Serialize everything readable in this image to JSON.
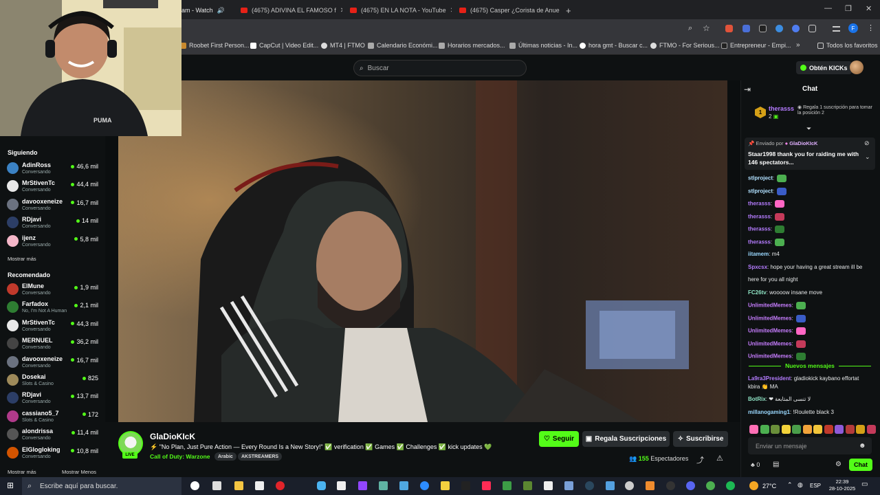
{
  "browser": {
    "tabs": [
      {
        "title": "am - Watch"
      },
      {
        "title": "(4675) ADIVINA EL FAMOSO f"
      },
      {
        "title": "(4675) EN LA NOTA - YouTube"
      },
      {
        "title": "(4675) Casper ¿Corista de Anue"
      }
    ],
    "bookmarks": [
      "Roobet First Person...",
      "CapCut | Video Edit...",
      "MT4 | FTMO",
      "Calendario Económi...",
      "Horarios mercados...",
      "Últimas noticias - In...",
      "hora gmt - Buscar c...",
      "FTMO - For Serious...",
      "Entrepreneur - Empi..."
    ],
    "all_bookmarks": "Todos los favoritos",
    "profile_initial": "F"
  },
  "header": {
    "search_placeholder": "Buscar",
    "get_kicks": "Obtén KICKs"
  },
  "sidebar": {
    "following_title": "Siguiendo",
    "following": [
      {
        "name": "AdinRoss",
        "sub": "Conversando",
        "viewers": "46,6 mil",
        "color": "#3b82c4"
      },
      {
        "name": "MrStivenTc",
        "sub": "Conversando",
        "viewers": "44,4 mil",
        "color": "#e8e8e8"
      },
      {
        "name": "davooxeneize",
        "sub": "Conversando",
        "viewers": "16,7 mil",
        "color": "#6b7280"
      },
      {
        "name": "RDjavi",
        "sub": "Conversando",
        "viewers": "14 mil",
        "color": "#2c3e66"
      },
      {
        "name": "ijenz",
        "sub": "Conversando",
        "viewers": "5,8 mil",
        "color": "#f4b6c8"
      }
    ],
    "show_more": "Mostrar más",
    "recommended_title": "Recomendado",
    "recommended": [
      {
        "name": "ElMune",
        "sub": "Conversando",
        "viewers": "1,9 mil",
        "color": "#c0392b"
      },
      {
        "name": "Farfadox",
        "sub": "No, I'm Not A Human",
        "viewers": "2,1 mil",
        "color": "#2e7d32"
      },
      {
        "name": "MrStivenTc",
        "sub": "Conversando",
        "viewers": "44,3 mil",
        "color": "#e8e8e8"
      },
      {
        "name": "MERNUEL",
        "sub": "Conversando",
        "viewers": "36,2 mil",
        "color": "#444"
      },
      {
        "name": "davooxeneize",
        "sub": "Conversando",
        "viewers": "16,7 mil",
        "color": "#6b7280"
      },
      {
        "name": "Dosekai",
        "sub": "Slots & Casino",
        "viewers": "825",
        "color": "#9e8a5a"
      },
      {
        "name": "RDjavi",
        "sub": "Conversando",
        "viewers": "13,7 mil",
        "color": "#2c3e66"
      },
      {
        "name": "cassiano5_7",
        "sub": "Slots & Casino",
        "viewers": "172",
        "color": "#b03a8a"
      },
      {
        "name": "alondrissa",
        "sub": "Conversando",
        "viewers": "11,4 mil",
        "color": "#555"
      },
      {
        "name": "ElGlogloking",
        "sub": "Conversando",
        "viewers": "10,8 mil",
        "color": "#d35400"
      }
    ],
    "show_more_2": "Mostrar más",
    "show_less": "Mostrar Menos"
  },
  "stream": {
    "channel": "GlaDioKIcK",
    "live": "LIVE",
    "title": "⚡ \"No Plan, Just Pure Action — Every Round Is a New Story!\" ✅ verification ✅ Games ✅ Challenges ✅ kick updates 💚",
    "category": "Call of Duty: Warzone",
    "tags": [
      "Arabic",
      "AKSTREAMERS"
    ],
    "follow": "Seguir",
    "gift": "Regala Suscripciones",
    "subscribe": "Suscribirse",
    "viewers_count": "155",
    "viewers_label": "Espectadores"
  },
  "chat": {
    "title": "Chat",
    "top_gifter": {
      "name": "therasss",
      "rank": "1",
      "count": "2",
      "cta": "Regala 1 suscripción para tomar la posición 2"
    },
    "pinned": {
      "by_label": "Enviado por",
      "by_user": "GlaDioKIcK",
      "text": "Staar1998 thank you for raiding me with 146 spectators..."
    },
    "messages": [
      {
        "user": "stlproject",
        "text": "",
        "color": "#b0e0ff"
      },
      {
        "user": "stlproject",
        "text": "",
        "color": "#b0e0ff"
      },
      {
        "user": "therasss",
        "text": "",
        "color": "#b57cff"
      },
      {
        "user": "therasss",
        "text": "",
        "color": "#b57cff"
      },
      {
        "user": "therasss",
        "text": "",
        "color": "#b57cff"
      },
      {
        "user": "therasss",
        "text": "",
        "color": "#b57cff"
      },
      {
        "user": "iitamem",
        "text": "m4",
        "color": "#9ad8ff"
      },
      {
        "user": "Spxcsx",
        "text": "hope your having a great stream ill be",
        "color": "#b57cff"
      },
      {
        "user": "",
        "text": "here for you all night",
        "color": "#fff"
      },
      {
        "user": "FC26tv",
        "text": "woooow insane move",
        "color": "#8fe3c4"
      },
      {
        "user": "UnlimitedMemes",
        "text": "",
        "color": "#c77dff"
      },
      {
        "user": "UnlimitedMemes",
        "text": "",
        "color": "#c77dff"
      },
      {
        "user": "UnlimitedMemes",
        "text": "",
        "color": "#c77dff"
      },
      {
        "user": "UnlimitedMemes",
        "text": "",
        "color": "#c77dff"
      },
      {
        "user": "UnlimitedMemes",
        "text": "",
        "color": "#c77dff"
      }
    ],
    "new_messages": "Nuevos mensajes",
    "after": [
      {
        "user": "La9ra3President",
        "text": "gladiokick kaybano effortat",
        "color": "#b57cff"
      },
      {
        "user": "",
        "text": "kbira 👏 MA",
        "color": "#fff"
      },
      {
        "user": "BotRix",
        "text": "❤ لا تنسى المتابعة",
        "color": "#8fe3c4"
      },
      {
        "user": "millanogaming1",
        "text": "!Roulette black 3",
        "color": "#9ad8ff"
      }
    ],
    "input_placeholder": "Enviar un mensaje",
    "kicks_count": "0",
    "send": "Chat"
  },
  "taskbar": {
    "search": "Escribe aquí para buscar.",
    "weather": "27°C",
    "lang": "ESP",
    "time": "22:39",
    "date": "28-10-2025"
  }
}
